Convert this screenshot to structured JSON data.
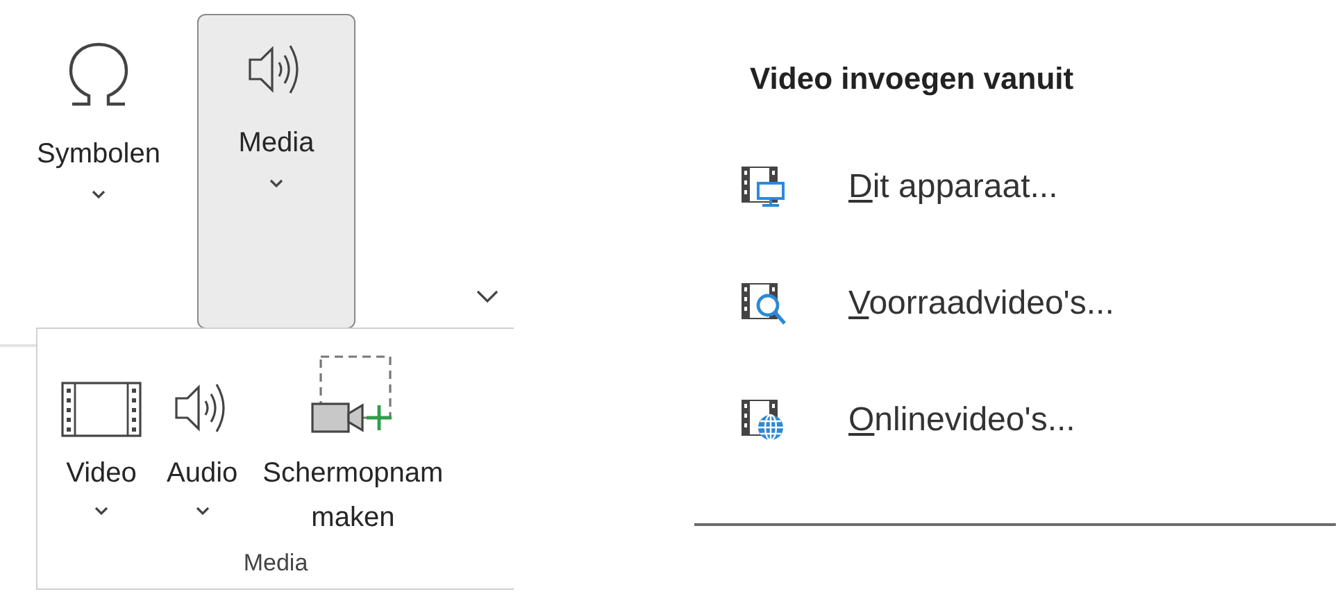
{
  "ribbon": {
    "buttons": [
      {
        "kind": "symbols",
        "label": "Symbolen",
        "selected": false,
        "has_dropdown": true
      },
      {
        "kind": "media",
        "label": "Media",
        "selected": true,
        "has_dropdown": true
      }
    ]
  },
  "media_flyout": {
    "buttons": [
      {
        "kind": "video",
        "label": "Video",
        "has_dropdown": true
      },
      {
        "kind": "audio",
        "label": "Audio",
        "has_dropdown": true
      },
      {
        "kind": "screen_recording",
        "label": "Schermopnam",
        "label_line2": "maken",
        "has_dropdown": false
      }
    ],
    "group_label": "Media"
  },
  "insert_video_menu": {
    "title": "Video invoegen vanuit",
    "items": [
      {
        "kind": "device",
        "label": "Dit apparaat...",
        "mnemonic_first": true
      },
      {
        "kind": "stock",
        "label": "Voorraadvideo's...",
        "mnemonic_first": true
      },
      {
        "kind": "online",
        "label": "Onlinevideo's...",
        "mnemonic_first": true
      }
    ]
  }
}
